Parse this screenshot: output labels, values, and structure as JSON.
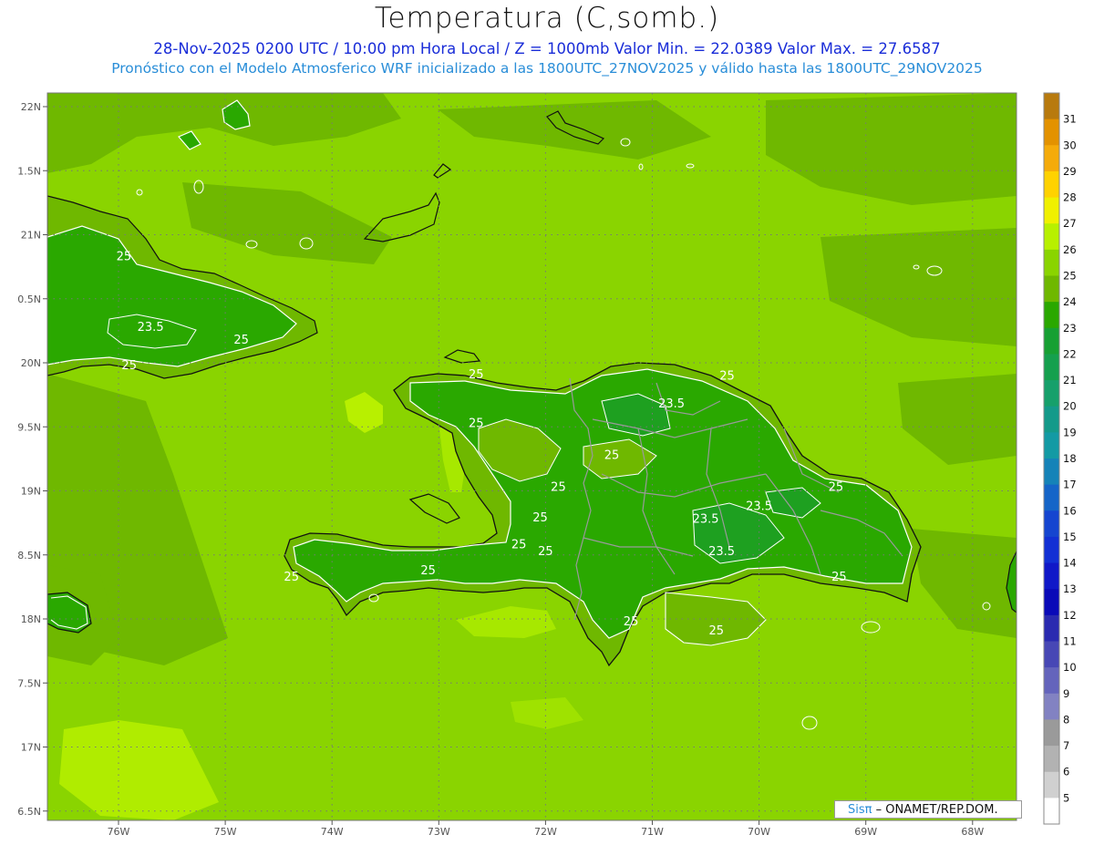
{
  "header": {
    "title": "Temperatura (C,somb.)",
    "line1": "28-Nov-2025 0200 UTC / 10:00 pm Hora Local / Z = 1000mb   Valor Min. = 22.0389   Valor Max. = 27.6587",
    "line2": "Pronóstico con el Modelo Atmosferico WRF inicializado a las 1800UTC_27NOV2025 y válido hasta las  1800UTC_29NOV2025"
  },
  "axes": {
    "lon_labels": [
      "76W",
      "75W",
      "74W",
      "73W",
      "72W",
      "71W",
      "70W",
      "69W",
      "68W"
    ],
    "lat_labels": [
      "22N",
      "1.5N",
      "21N",
      "0.5N",
      "20N",
      "9.5N",
      "19N",
      "8.5N",
      "18N",
      "7.5N",
      "17N",
      "6.5N"
    ]
  },
  "contour_labels": [
    {
      "text": "25",
      "lon": -75.95,
      "lat": 20.8
    },
    {
      "text": "23.5",
      "lon": -75.7,
      "lat": 20.25
    },
    {
      "text": "25",
      "lon": -74.85,
      "lat": 20.15
    },
    {
      "text": "25",
      "lon": -75.9,
      "lat": 19.95
    },
    {
      "text": "25",
      "lon": -72.65,
      "lat": 19.88
    },
    {
      "text": "25",
      "lon": -70.3,
      "lat": 19.87
    },
    {
      "text": "23.5",
      "lon": -70.82,
      "lat": 19.65
    },
    {
      "text": "25",
      "lon": -72.65,
      "lat": 19.5
    },
    {
      "text": "25",
      "lon": -71.38,
      "lat": 19.25
    },
    {
      "text": "25",
      "lon": -71.88,
      "lat": 19.0
    },
    {
      "text": "25",
      "lon": -69.28,
      "lat": 19.0
    },
    {
      "text": "23.5",
      "lon": -70.0,
      "lat": 18.85
    },
    {
      "text": "23.5",
      "lon": -70.5,
      "lat": 18.75
    },
    {
      "text": "25",
      "lon": -72.05,
      "lat": 18.76
    },
    {
      "text": "25",
      "lon": -72.25,
      "lat": 18.55
    },
    {
      "text": "25",
      "lon": -72.0,
      "lat": 18.5
    },
    {
      "text": "23.5",
      "lon": -70.35,
      "lat": 18.5
    },
    {
      "text": "25",
      "lon": -73.1,
      "lat": 18.35
    },
    {
      "text": "25",
      "lon": -74.38,
      "lat": 18.3
    },
    {
      "text": "25",
      "lon": -69.25,
      "lat": 18.3
    },
    {
      "text": "25",
      "lon": -71.2,
      "lat": 17.95
    },
    {
      "text": "25",
      "lon": -70.4,
      "lat": 17.88
    }
  ],
  "legend": {
    "values": [
      "31",
      "30",
      "29",
      "28",
      "27",
      "26",
      "25",
      "24",
      "23",
      "22",
      "21",
      "20",
      "19",
      "18",
      "17",
      "16",
      "15",
      "14",
      "13",
      "12",
      "11",
      "10",
      "9",
      "8",
      "7",
      "6",
      "5"
    ],
    "colors": [
      "#b87a0e",
      "#e39200",
      "#f5ab0a",
      "#ffd200",
      "#f0f000",
      "#b8f000",
      "#8ad400",
      "#6fb800",
      "#2aa800",
      "#17a033",
      "#15a04e",
      "#16a06b",
      "#149a8a",
      "#139aa4",
      "#1583b8",
      "#1565c8",
      "#1545d0",
      "#1230d4",
      "#1018c8",
      "#0a0ab8",
      "#2a2ab0",
      "#4747b5",
      "#6464bc",
      "#8282c2",
      "#9a9a9a",
      "#b2b2b2",
      "#d0d0d0",
      "#ffffff"
    ]
  },
  "credit": {
    "sis": "Sisπ",
    "rest": "– ONAMET/REP.DOM."
  }
}
